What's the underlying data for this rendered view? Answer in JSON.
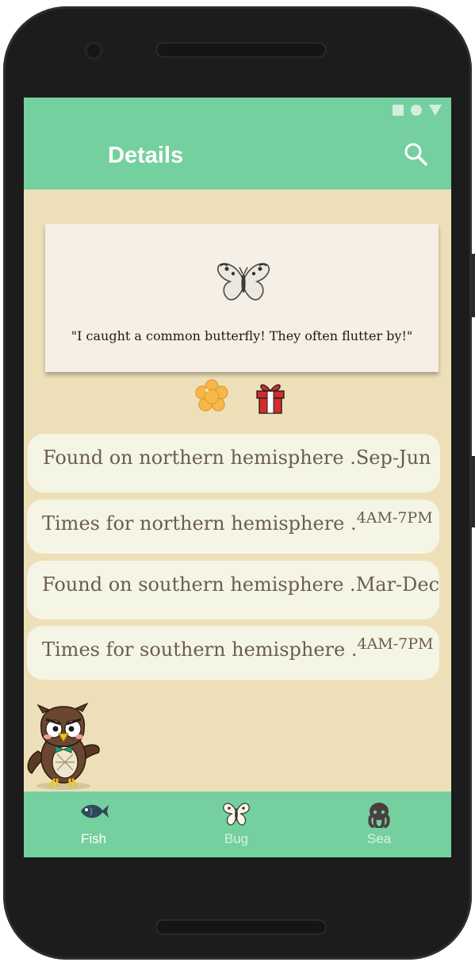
{
  "status_bar": {
    "icons": [
      "square-icon",
      "circle-icon",
      "triangle-signal-icon"
    ]
  },
  "appbar": {
    "title": "Details",
    "search_icon": "search-icon"
  },
  "card": {
    "image_icon": "butterfly-icon",
    "quote": "\"I caught a common butterfly! They often flutter by!\""
  },
  "badges": {
    "left": "flower-icon",
    "right": "gift-icon"
  },
  "info_rows": [
    {
      "label": "Found on northern hemisphere .",
      "value": "Sep-Jun"
    },
    {
      "label": "Times for northern hemisphere .",
      "value": "4AM-7PM"
    },
    {
      "label": "Found on southern hemisphere .",
      "value": "Mar-Dec"
    },
    {
      "label": "Times for southern hemisphere .",
      "value": "4AM-7PM"
    }
  ],
  "mascot": "owl-curator-icon",
  "bottom_nav": [
    {
      "label": "Fish",
      "icon": "fish-icon",
      "active": true
    },
    {
      "label": "Bug",
      "icon": "bug-icon",
      "active": false
    },
    {
      "label": "Sea",
      "icon": "octopus-icon",
      "active": false
    }
  ],
  "colors": {
    "accent": "#75d09f",
    "background": "#ede0b8",
    "row_background": "#f5f5e6",
    "row_text": "#6b5e4a",
    "nav_active": "#ffffff",
    "nav_inactive": "#d8f2e4"
  }
}
